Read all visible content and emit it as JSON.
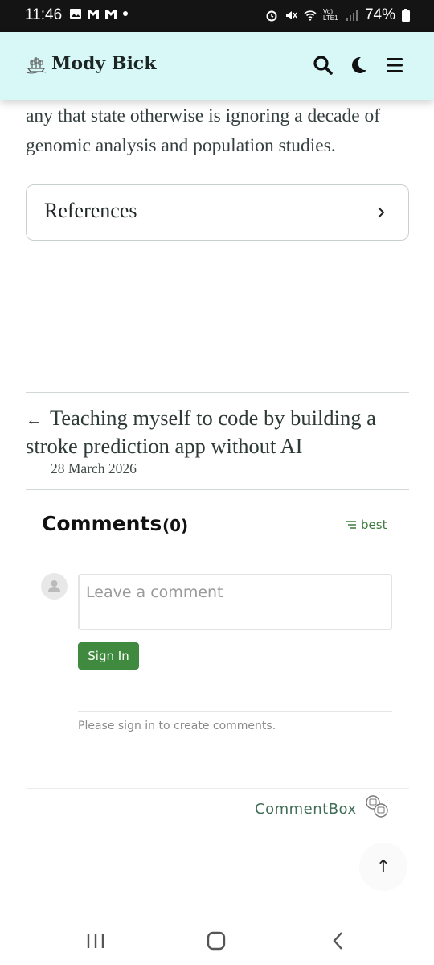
{
  "status_bar": {
    "time": "11:46",
    "battery": "74%",
    "network": "Vo) LTE1"
  },
  "header": {
    "brand": "Mody Bick",
    "icons": [
      "ship-logo-icon",
      "search-icon",
      "dark-mode-moon-icon",
      "menu-hamburger-icon"
    ]
  },
  "article": {
    "tail_text": "any that state otherwise is ignoring a decade of genomic analysis and population studies."
  },
  "references": {
    "label": "References"
  },
  "prev_post": {
    "arrow": "←",
    "title": "Teaching myself to code by building a stroke prediction app without AI",
    "date": "28 March 2026"
  },
  "comments": {
    "title": "Comments",
    "count": "(0)",
    "sort_label": "best",
    "placeholder": "Leave a comment",
    "sign_in_label": "Sign In",
    "sign_in_note": "Please sign in to create comments.",
    "powered_by": "CommentBox"
  },
  "back_to_top": "↑",
  "colors": {
    "header_bg": "#d7f8f7",
    "accent_green": "#3f8a3f"
  }
}
